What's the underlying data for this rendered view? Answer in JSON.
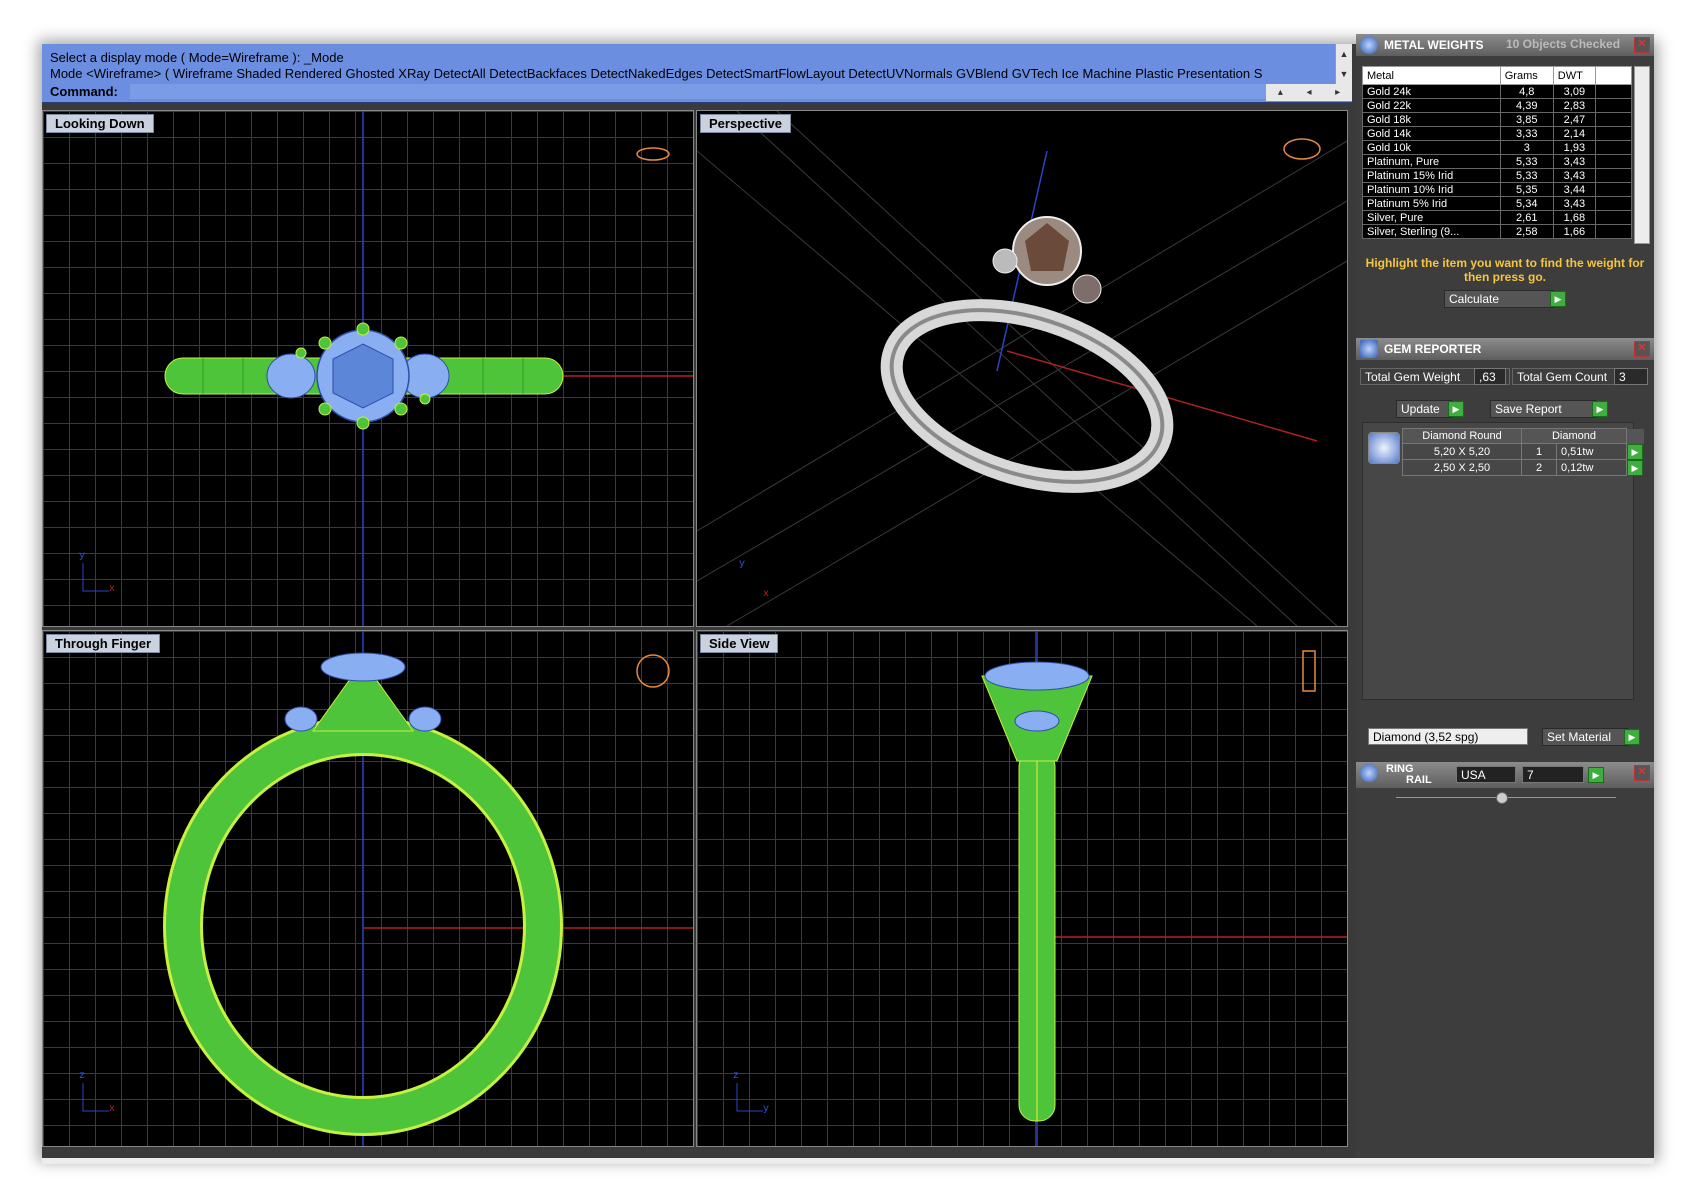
{
  "command": {
    "prompt_line": "Select a display mode ( Mode=Wireframe ): _Mode",
    "mode_line": "Mode <Wireframe> ( Wireframe  Shaded  Rendered  Ghosted  XRay  DetectAll  DetectBackfaces  DetectNakedEdges  DetectSmartFlowLayout  DetectUVNormals  GVBlend  GVTech  Ice  Machine  Plastic  Presentation  S",
    "label": "Command:"
  },
  "viewports": {
    "top_left": {
      "title": "Looking Down",
      "axis_x": "x",
      "axis_y": "y"
    },
    "top_right": {
      "title": "Perspective",
      "axis_x": "x",
      "axis_y": "y"
    },
    "bottom_left": {
      "title": "Through Finger",
      "axis_x": "x",
      "axis_y": "z"
    },
    "bottom_right": {
      "title": "Side View",
      "axis_x": "y",
      "axis_y": "z"
    }
  },
  "metal_weights": {
    "title": "METAL WEIGHTS",
    "status": "10 Objects Checked",
    "columns": [
      "Metal",
      "Grams",
      "DWT"
    ],
    "rows": [
      [
        "Gold 24k",
        "4,8",
        "3,09"
      ],
      [
        "Gold 22k",
        "4,39",
        "2,83"
      ],
      [
        "Gold 18k",
        "3,85",
        "2,47"
      ],
      [
        "Gold 14k",
        "3,33",
        "2,14"
      ],
      [
        "Gold 10k",
        "3",
        "1,93"
      ],
      [
        "Platinum, Pure",
        "5,33",
        "3,43"
      ],
      [
        "Platinum 15% Irid",
        "5,33",
        "3,43"
      ],
      [
        "Platinum 10% Irid",
        "5,35",
        "3,44"
      ],
      [
        "Platinum 5% Irid",
        "5,34",
        "3,43"
      ],
      [
        "Silver, Pure",
        "2,61",
        "1,68"
      ],
      [
        "Silver, Sterling (9...",
        "2,58",
        "1,66"
      ]
    ],
    "hint": "Highlight the item you want to find the weight for then press go.",
    "calculate": "Calculate"
  },
  "gem_reporter": {
    "title": "GEM REPORTER",
    "total_weight_label": "Total Gem Weight",
    "total_weight_value": ",63",
    "total_count_label": "Total Gem Count",
    "total_count_value": "3",
    "update": "Update",
    "save_report": "Save Report",
    "gem_header": [
      "Diamond Round",
      "Diamond"
    ],
    "gems": [
      [
        "5,20 X 5,20",
        "1",
        "0,51tw"
      ],
      [
        "2,50 X 2,50",
        "2",
        "0,12tw"
      ]
    ],
    "material": "Diamond    (3,52 spg)",
    "set_material": "Set Material"
  },
  "ring_rail": {
    "title_1": "RING",
    "title_2": "RAIL",
    "region": "USA",
    "size": "7"
  },
  "colors": {
    "command_bar": "#6b8ee0",
    "wire_green": "#4ec43a",
    "gem_blue": "#8aaef2",
    "hint_yellow": "#f5c542"
  }
}
